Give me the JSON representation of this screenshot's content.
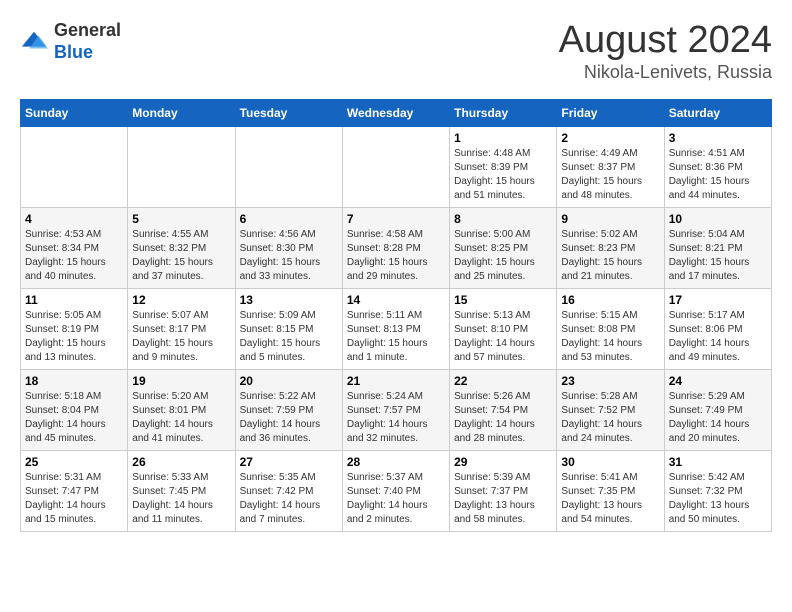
{
  "logo": {
    "general": "General",
    "blue": "Blue"
  },
  "title": "August 2024",
  "subtitle": "Nikola-Lenivets, Russia",
  "weekdays": [
    "Sunday",
    "Monday",
    "Tuesday",
    "Wednesday",
    "Thursday",
    "Friday",
    "Saturday"
  ],
  "weeks": [
    [
      {
        "day": "",
        "info": ""
      },
      {
        "day": "",
        "info": ""
      },
      {
        "day": "",
        "info": ""
      },
      {
        "day": "",
        "info": ""
      },
      {
        "day": "1",
        "info": "Sunrise: 4:48 AM\nSunset: 8:39 PM\nDaylight: 15 hours\nand 51 minutes."
      },
      {
        "day": "2",
        "info": "Sunrise: 4:49 AM\nSunset: 8:37 PM\nDaylight: 15 hours\nand 48 minutes."
      },
      {
        "day": "3",
        "info": "Sunrise: 4:51 AM\nSunset: 8:36 PM\nDaylight: 15 hours\nand 44 minutes."
      }
    ],
    [
      {
        "day": "4",
        "info": "Sunrise: 4:53 AM\nSunset: 8:34 PM\nDaylight: 15 hours\nand 40 minutes."
      },
      {
        "day": "5",
        "info": "Sunrise: 4:55 AM\nSunset: 8:32 PM\nDaylight: 15 hours\nand 37 minutes."
      },
      {
        "day": "6",
        "info": "Sunrise: 4:56 AM\nSunset: 8:30 PM\nDaylight: 15 hours\nand 33 minutes."
      },
      {
        "day": "7",
        "info": "Sunrise: 4:58 AM\nSunset: 8:28 PM\nDaylight: 15 hours\nand 29 minutes."
      },
      {
        "day": "8",
        "info": "Sunrise: 5:00 AM\nSunset: 8:25 PM\nDaylight: 15 hours\nand 25 minutes."
      },
      {
        "day": "9",
        "info": "Sunrise: 5:02 AM\nSunset: 8:23 PM\nDaylight: 15 hours\nand 21 minutes."
      },
      {
        "day": "10",
        "info": "Sunrise: 5:04 AM\nSunset: 8:21 PM\nDaylight: 15 hours\nand 17 minutes."
      }
    ],
    [
      {
        "day": "11",
        "info": "Sunrise: 5:05 AM\nSunset: 8:19 PM\nDaylight: 15 hours\nand 13 minutes."
      },
      {
        "day": "12",
        "info": "Sunrise: 5:07 AM\nSunset: 8:17 PM\nDaylight: 15 hours\nand 9 minutes."
      },
      {
        "day": "13",
        "info": "Sunrise: 5:09 AM\nSunset: 8:15 PM\nDaylight: 15 hours\nand 5 minutes."
      },
      {
        "day": "14",
        "info": "Sunrise: 5:11 AM\nSunset: 8:13 PM\nDaylight: 15 hours\nand 1 minute."
      },
      {
        "day": "15",
        "info": "Sunrise: 5:13 AM\nSunset: 8:10 PM\nDaylight: 14 hours\nand 57 minutes."
      },
      {
        "day": "16",
        "info": "Sunrise: 5:15 AM\nSunset: 8:08 PM\nDaylight: 14 hours\nand 53 minutes."
      },
      {
        "day": "17",
        "info": "Sunrise: 5:17 AM\nSunset: 8:06 PM\nDaylight: 14 hours\nand 49 minutes."
      }
    ],
    [
      {
        "day": "18",
        "info": "Sunrise: 5:18 AM\nSunset: 8:04 PM\nDaylight: 14 hours\nand 45 minutes."
      },
      {
        "day": "19",
        "info": "Sunrise: 5:20 AM\nSunset: 8:01 PM\nDaylight: 14 hours\nand 41 minutes."
      },
      {
        "day": "20",
        "info": "Sunrise: 5:22 AM\nSunset: 7:59 PM\nDaylight: 14 hours\nand 36 minutes."
      },
      {
        "day": "21",
        "info": "Sunrise: 5:24 AM\nSunset: 7:57 PM\nDaylight: 14 hours\nand 32 minutes."
      },
      {
        "day": "22",
        "info": "Sunrise: 5:26 AM\nSunset: 7:54 PM\nDaylight: 14 hours\nand 28 minutes."
      },
      {
        "day": "23",
        "info": "Sunrise: 5:28 AM\nSunset: 7:52 PM\nDaylight: 14 hours\nand 24 minutes."
      },
      {
        "day": "24",
        "info": "Sunrise: 5:29 AM\nSunset: 7:49 PM\nDaylight: 14 hours\nand 20 minutes."
      }
    ],
    [
      {
        "day": "25",
        "info": "Sunrise: 5:31 AM\nSunset: 7:47 PM\nDaylight: 14 hours\nand 15 minutes."
      },
      {
        "day": "26",
        "info": "Sunrise: 5:33 AM\nSunset: 7:45 PM\nDaylight: 14 hours\nand 11 minutes."
      },
      {
        "day": "27",
        "info": "Sunrise: 5:35 AM\nSunset: 7:42 PM\nDaylight: 14 hours\nand 7 minutes."
      },
      {
        "day": "28",
        "info": "Sunrise: 5:37 AM\nSunset: 7:40 PM\nDaylight: 14 hours\nand 2 minutes."
      },
      {
        "day": "29",
        "info": "Sunrise: 5:39 AM\nSunset: 7:37 PM\nDaylight: 13 hours\nand 58 minutes."
      },
      {
        "day": "30",
        "info": "Sunrise: 5:41 AM\nSunset: 7:35 PM\nDaylight: 13 hours\nand 54 minutes."
      },
      {
        "day": "31",
        "info": "Sunrise: 5:42 AM\nSunset: 7:32 PM\nDaylight: 13 hours\nand 50 minutes."
      }
    ]
  ]
}
